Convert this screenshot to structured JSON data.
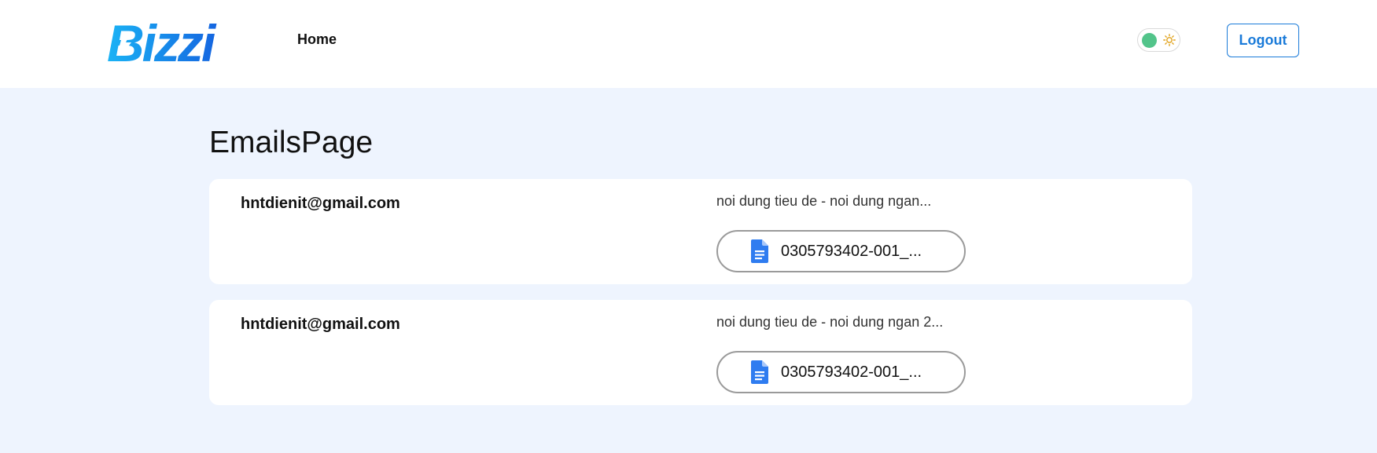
{
  "header": {
    "logo_text": "Bizzi",
    "nav_home": "Home",
    "logout_label": "Logout",
    "theme_toggle_state": "light",
    "toggle_knob_color": "#52c48a",
    "accent_color": "#1b7bd9"
  },
  "main": {
    "title": "EmailsPage",
    "emails": [
      {
        "sender": "hntdienit@gmail.com",
        "subject": "noi dung tieu de - noi dung ngan...",
        "attachment": {
          "name": "0305793402-001_...",
          "icon": "google-doc-icon"
        }
      },
      {
        "sender": "hntdienit@gmail.com",
        "subject": "noi dung tieu de - noi dung ngan 2...",
        "attachment": {
          "name": "0305793402-001_...",
          "icon": "google-doc-icon"
        }
      }
    ]
  }
}
